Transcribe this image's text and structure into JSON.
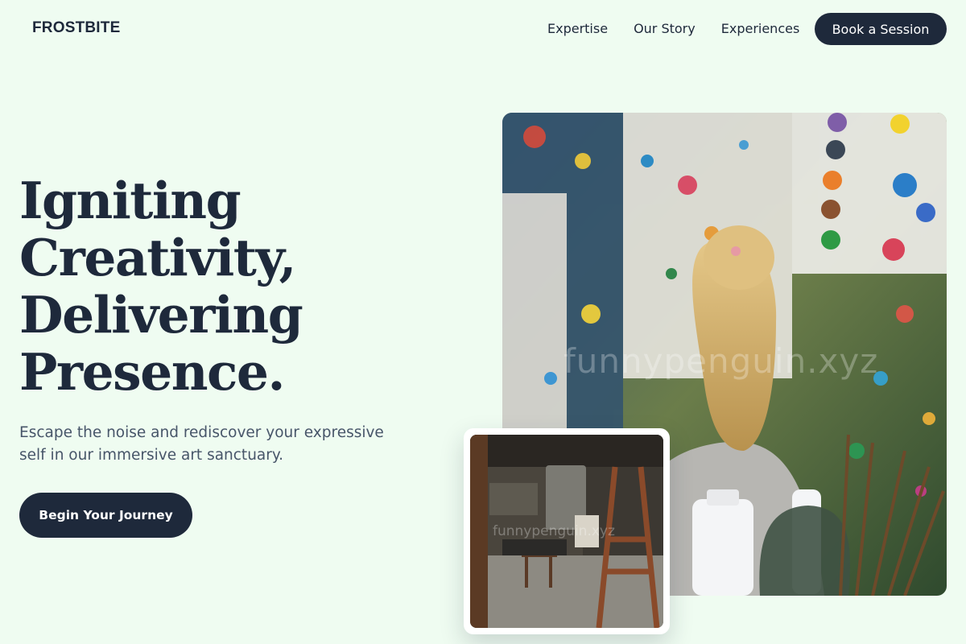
{
  "brand": {
    "logo": "FROSTBITE"
  },
  "nav": {
    "links": [
      "Expertise",
      "Our Story",
      "Experiences"
    ],
    "cta": "Book a Session"
  },
  "hero": {
    "title_lines": [
      "Igniting",
      "Creativity,",
      "Delivering",
      "Presence."
    ],
    "subtitle": "Escape the noise and rediscover your expressive self in our immersive art sanctuary.",
    "cta": "Begin Your Journey"
  },
  "images": {
    "main_image": "child painting on paint-splattered studio wall",
    "card_image": "art studio interior with wooden easels",
    "watermark": "funnypenguin.xyz",
    "card_watermark": "funnypenguin.xyz"
  },
  "colors": {
    "background": "#effcf1",
    "primary": "#1e293b",
    "text_muted": "#475569",
    "button_text": "#ffffff"
  }
}
